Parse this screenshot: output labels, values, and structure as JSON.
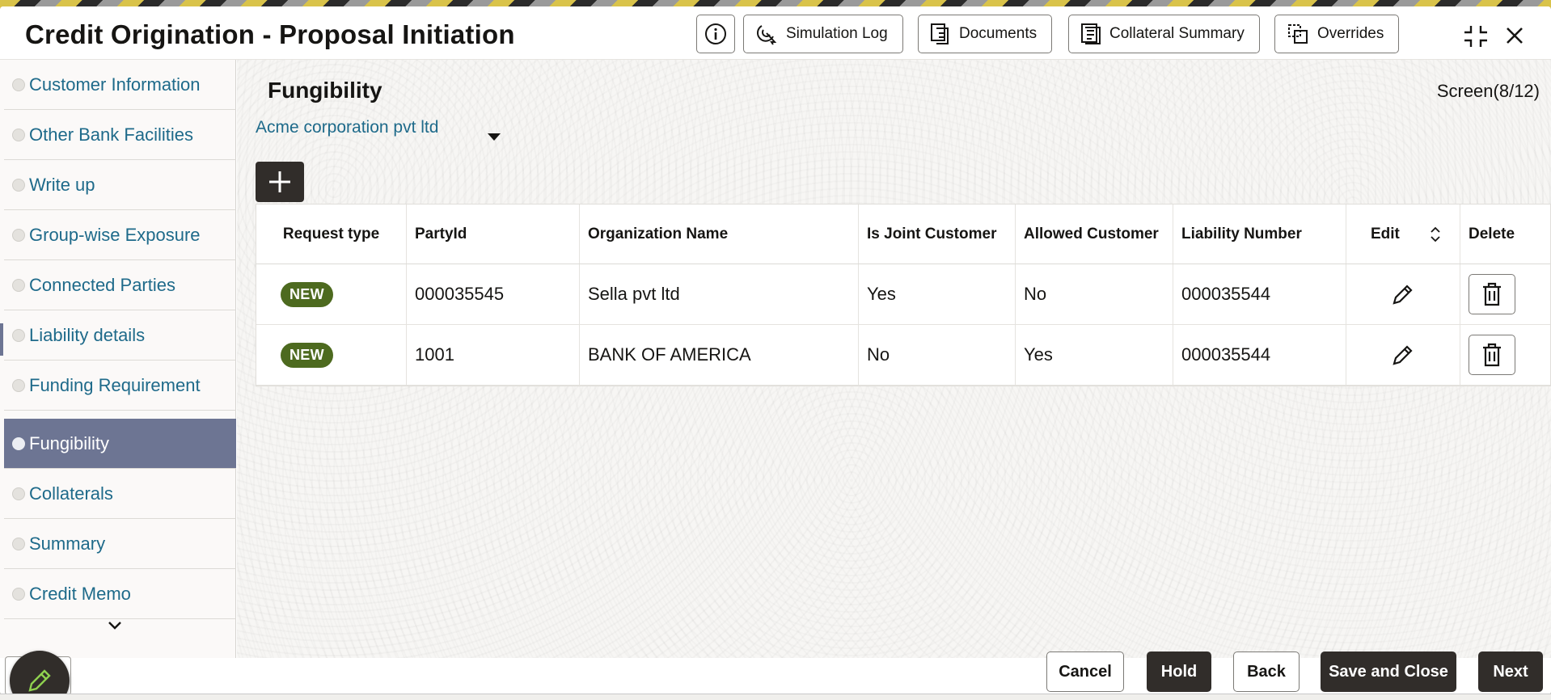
{
  "header": {
    "title": "Credit Origination - Proposal Initiation",
    "info_icon": "info-icon",
    "simulation_log": "Simulation Log",
    "documents": "Documents",
    "collateral_summary": "Collateral Summary",
    "overrides": "Overrides"
  },
  "sidebar": {
    "items": [
      {
        "label": "Customer Information"
      },
      {
        "label": "Other Bank Facilities"
      },
      {
        "label": "Write up"
      },
      {
        "label": "Group-wise Exposure"
      },
      {
        "label": "Connected Parties"
      },
      {
        "label": "Liability details"
      },
      {
        "label": "Funding Requirement"
      },
      {
        "label": "Fungibility",
        "active": true
      },
      {
        "label": "Collaterals"
      },
      {
        "label": "Summary"
      },
      {
        "label": "Credit Memo"
      }
    ]
  },
  "main": {
    "section_title": "Fungibility",
    "screen_count": "Screen(8/12)",
    "party_select_value": "Acme corporation pvt ltd",
    "columns": [
      "Request type",
      "PartyId",
      "Organization Name",
      "Is Joint Customer",
      "Allowed Customer",
      "Liability Number",
      "Edit",
      "Delete"
    ],
    "rows": [
      {
        "request_type": "NEW",
        "party_id": "000035545",
        "org_name": "Sella pvt ltd",
        "is_joint": "Yes",
        "allowed": "No",
        "liability_number": "000035544"
      },
      {
        "request_type": "NEW",
        "party_id": "1001",
        "org_name": "BANK OF AMERICA",
        "is_joint": "No",
        "allowed": "Yes",
        "liability_number": "000035544"
      }
    ]
  },
  "footer": {
    "cancel": "Cancel",
    "hold": "Hold",
    "back": "Back",
    "save_close": "Save and Close",
    "next": "Next"
  },
  "colors": {
    "accent_dark": "#312d2a",
    "link": "#1e6a8a",
    "active_nav": "#6d7593",
    "badge_new": "#4d6a1f"
  }
}
